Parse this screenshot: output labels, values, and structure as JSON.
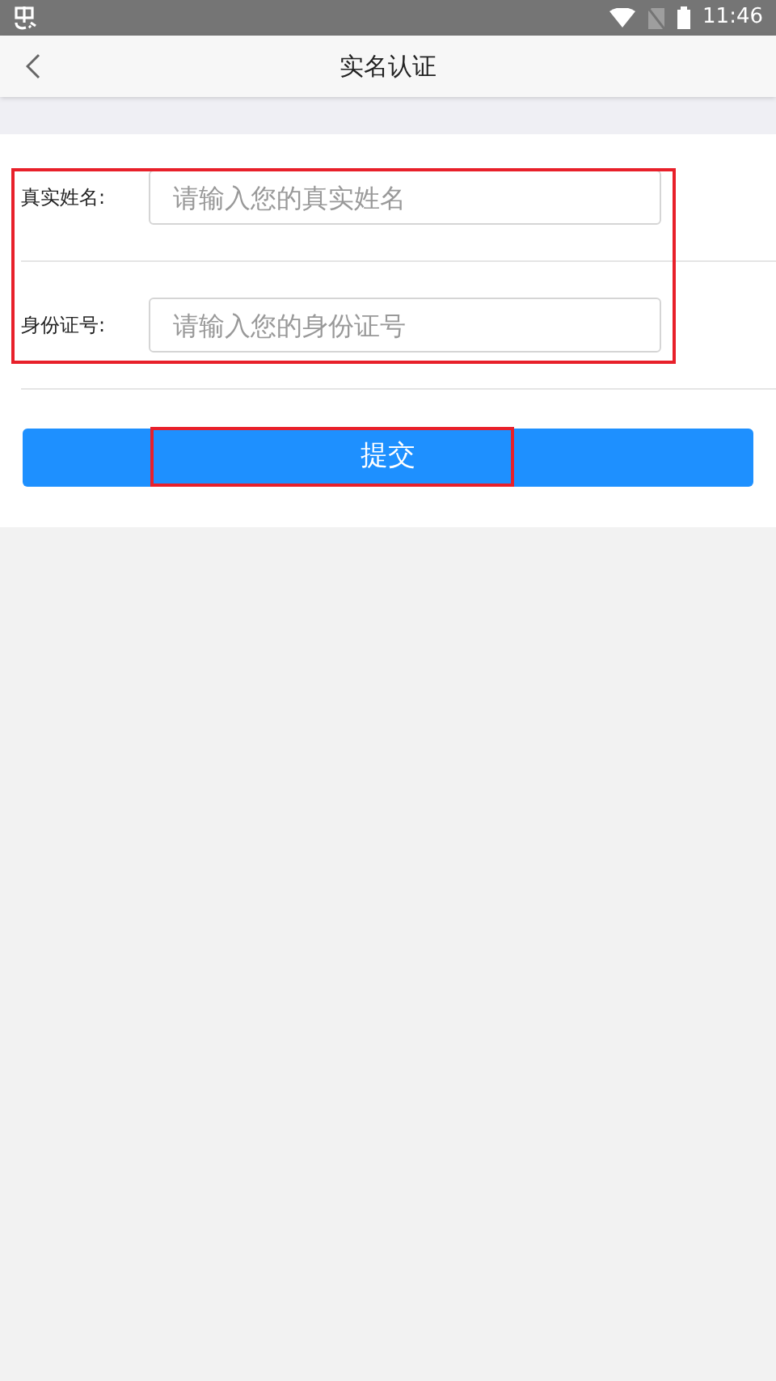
{
  "status_bar": {
    "time": "11:46"
  },
  "header": {
    "title": "实名认证"
  },
  "form": {
    "highlighted": true,
    "fields": [
      {
        "label": "真实姓名:",
        "placeholder": "请输入您的真实姓名"
      },
      {
        "label": "身份证号:",
        "placeholder": "请输入您的身份证号"
      }
    ]
  },
  "submit_button": {
    "label": "提交",
    "highlighted": true
  }
}
